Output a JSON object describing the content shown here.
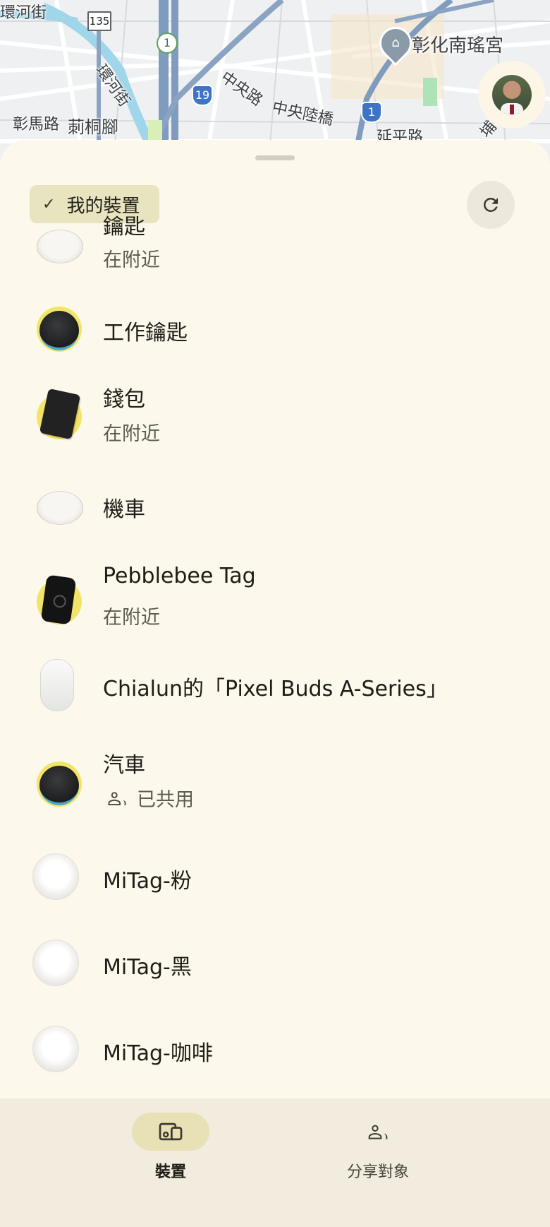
{
  "map": {
    "labels": [
      "環河街",
      "彰化南瑤宮",
      "環河街",
      "中央路",
      "中央陸橋",
      "彰馬路",
      "莿桐腳",
      "延平路",
      "埔"
    ],
    "route_shields": [
      "135",
      "1",
      "19",
      "1"
    ],
    "poi_icon": "museum-icon",
    "road_color": "#7f9bbd",
    "water_color": "#9fd6ea"
  },
  "filter_chip": {
    "icon": "check-icon",
    "label": "我的裝置"
  },
  "refresh": {
    "icon": "refresh-icon"
  },
  "devices": [
    {
      "title": "鑰匙",
      "subtitle": "在附近",
      "icon": "white-round-tag-icon"
    },
    {
      "title": "工作鑰匙",
      "subtitle": "",
      "icon": "black-tag-icon"
    },
    {
      "title": "錢包",
      "subtitle": "在附近",
      "icon": "wallet-card-icon"
    },
    {
      "title": "機車",
      "subtitle": "",
      "icon": "white-round-tag-icon"
    },
    {
      "title": "Pebblebee Tag",
      "subtitle": "在附近",
      "icon": "pebblebee-tag-icon"
    },
    {
      "title": "Chialun的「Pixel Buds A-Series」",
      "subtitle": "",
      "icon": "earbuds-case-icon"
    },
    {
      "title": "汽車",
      "subtitle": "已共用",
      "subtitle_icon": "people-icon",
      "icon": "black-tag-icon"
    },
    {
      "title": "MiTag-粉",
      "subtitle": "",
      "icon": "mitag-icon"
    },
    {
      "title": "MiTag-黑",
      "subtitle": "",
      "icon": "mitag-icon"
    },
    {
      "title": "MiTag-咖啡",
      "subtitle": "",
      "icon": "mitag-icon"
    }
  ],
  "nav": [
    {
      "label": "裝置",
      "icon": "devices-icon",
      "active": true
    },
    {
      "label": "分享對象",
      "icon": "people-icon",
      "active": false
    }
  ],
  "colors": {
    "sheet_bg": "#fcf8ec",
    "chip_bg": "#e8e4c0",
    "nav_bg": "#f1ecdd",
    "nav_active": "#e8e1b5",
    "tag_yellow": "#f3e468"
  }
}
